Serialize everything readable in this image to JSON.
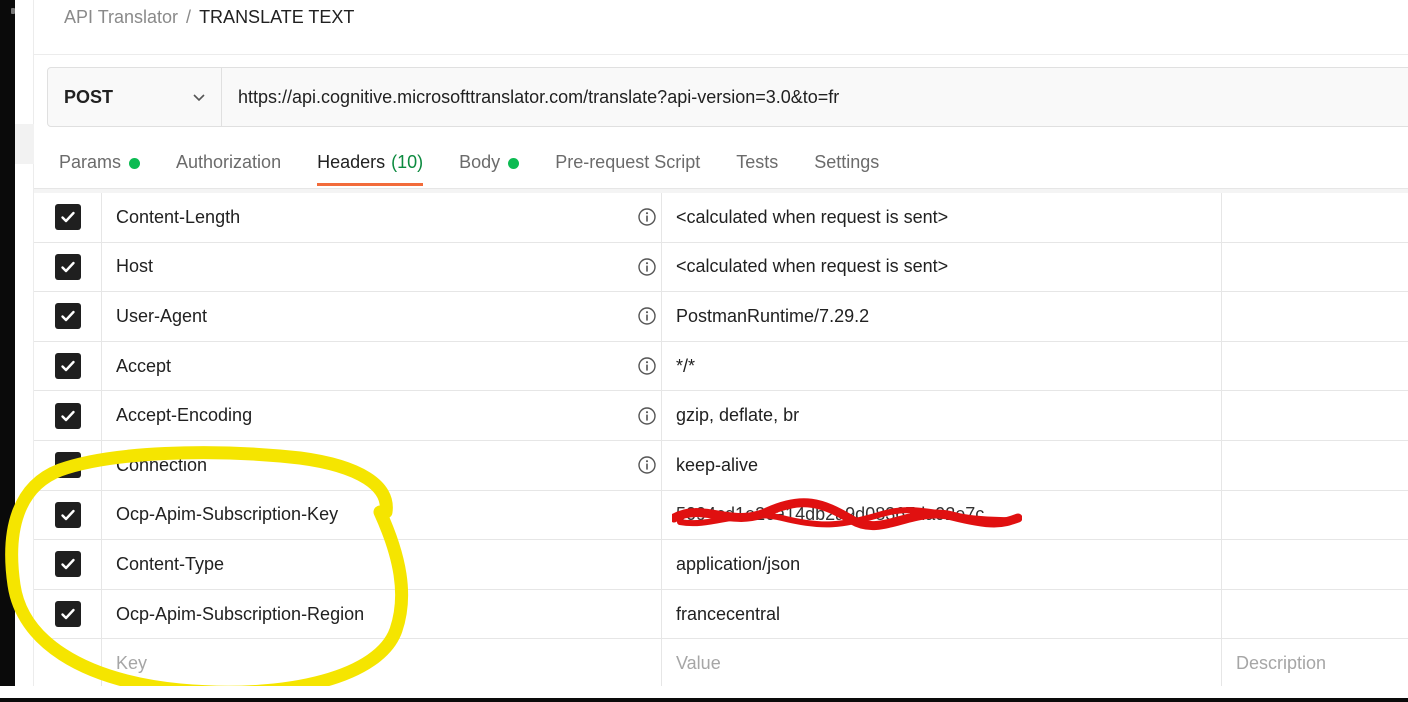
{
  "breadcrumb": {
    "parent": "API Translator",
    "separator": "/",
    "current": "TRANSLATE TEXT"
  },
  "request": {
    "method": "POST",
    "url": "https://api.cognitive.microsofttranslator.com/translate?api-version=3.0&to=fr"
  },
  "tabs": [
    {
      "label": "Params",
      "count": "",
      "dot": true
    },
    {
      "label": "Authorization",
      "count": "",
      "dot": false
    },
    {
      "label": "Headers",
      "count": "(10)",
      "dot": false,
      "active": true
    },
    {
      "label": "Body",
      "count": "",
      "dot": true
    },
    {
      "label": "Pre-request Script",
      "count": "",
      "dot": false
    },
    {
      "label": "Tests",
      "count": "",
      "dot": false
    },
    {
      "label": "Settings",
      "count": "",
      "dot": false
    }
  ],
  "headers": [
    {
      "key": "Content-Length",
      "value": "<calculated when request is sent>",
      "info": true,
      "checked": true
    },
    {
      "key": "Host",
      "value": "<calculated when request is sent>",
      "info": true,
      "checked": true
    },
    {
      "key": "User-Agent",
      "value": "PostmanRuntime/7.29.2",
      "info": true,
      "checked": true
    },
    {
      "key": "Accept",
      "value": "*/*",
      "info": true,
      "checked": true
    },
    {
      "key": "Accept-Encoding",
      "value": "gzip, deflate, br",
      "info": true,
      "checked": true
    },
    {
      "key": "Connection",
      "value": "keep-alive",
      "info": true,
      "checked": true
    },
    {
      "key": "Ocp-Apim-Subscription-Key",
      "value": "5094cd1e26a14db2a9d08367da92e7c",
      "info": false,
      "checked": true,
      "redacted": true
    },
    {
      "key": "Content-Type",
      "value": "application/json",
      "info": false,
      "checked": true
    },
    {
      "key": "Ocp-Apim-Subscription-Region",
      "value": "francecentral",
      "info": false,
      "checked": true
    }
  ],
  "new_row": {
    "key_placeholder": "Key",
    "value_placeholder": "Value",
    "description_placeholder": "Description"
  },
  "colors": {
    "accent": "#f26b3a",
    "status_dot": "#0cbb52",
    "count": "#0c8a3f",
    "highlight": "#f5e500",
    "redaction": "#e01010"
  }
}
